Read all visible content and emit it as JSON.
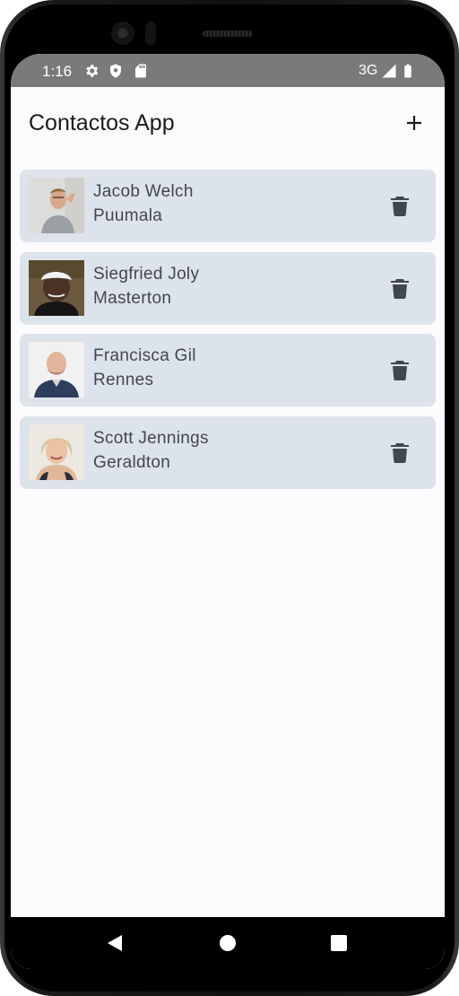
{
  "status_bar": {
    "time": "1:16",
    "icons": [
      "settings-icon",
      "shield-icon",
      "sd-card-icon"
    ],
    "network": "3G",
    "right_icons": [
      "signal-icon",
      "battery-icon"
    ]
  },
  "app_bar": {
    "title": "Contactos App",
    "add_icon": "plus-icon"
  },
  "contacts": [
    {
      "name": "Jacob Welch",
      "city": "Puumala",
      "delete_icon": "trash-icon"
    },
    {
      "name": "Siegfried Joly",
      "city": "Masterton",
      "delete_icon": "trash-icon"
    },
    {
      "name": "Francisca Gil",
      "city": "Rennes",
      "delete_icon": "trash-icon"
    },
    {
      "name": "Scott Jennings",
      "city": "Geraldton",
      "delete_icon": "trash-icon"
    }
  ],
  "nav_bar": {
    "buttons": [
      "back-icon",
      "home-icon",
      "recents-icon"
    ]
  },
  "colors": {
    "status_bar": "#7a7a7a",
    "background": "#fbfbfe",
    "card": "#dde3ea",
    "text_primary": "#1a1c1e",
    "text_secondary": "#41484d",
    "icon": "#41484d"
  }
}
